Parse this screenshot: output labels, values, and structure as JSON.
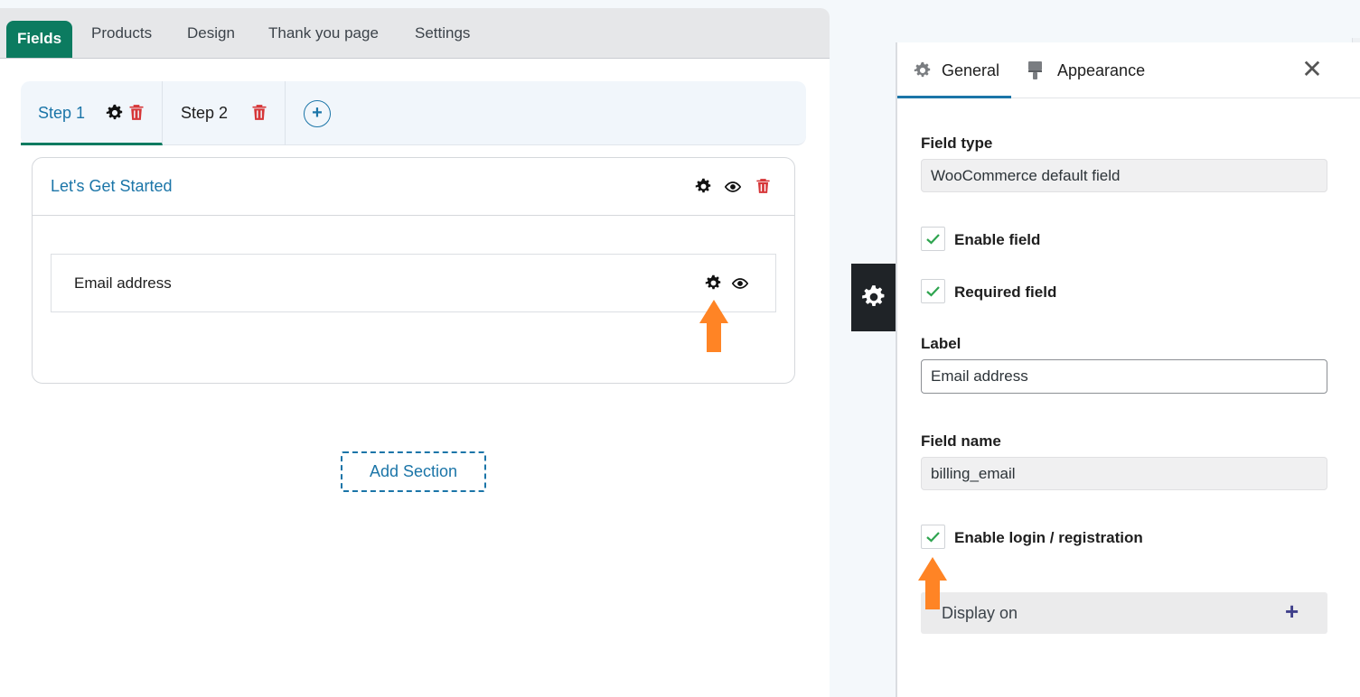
{
  "top_tabs": [
    "Fields",
    "Products",
    "Design",
    "Thank you page",
    "Settings"
  ],
  "steps": [
    {
      "label": "Step 1"
    },
    {
      "label": "Step 2"
    }
  ],
  "add_step_symbol": "+",
  "section": {
    "title": "Let's Get Started",
    "field_label": "Email address"
  },
  "add_section_label": "Add Section",
  "panel": {
    "tabs": {
      "general": "General",
      "appearance": "Appearance"
    },
    "close_symbol": "✕",
    "field_type_label": "Field type",
    "field_type_value": "WooCommerce default field",
    "enable_field_label": "Enable field",
    "required_field_label": "Required field",
    "label_label": "Label",
    "label_value": "Email address",
    "field_name_label": "Field name",
    "field_name_value": "billing_email",
    "enable_login_label": "Enable login / registration",
    "display_on_label": "Display on",
    "display_on_symbol": "+"
  },
  "colors": {
    "accent_green": "#0c7b60",
    "link_blue": "#1b75a8",
    "delete_red": "#d63638",
    "arrow_orange": "#ff8425",
    "check_green": "#2ea44f"
  },
  "icons": [
    "gear-icon",
    "trash-icon",
    "eye-icon",
    "plus-icon",
    "paint-brush-icon",
    "close-icon",
    "check-icon",
    "arrow-up-icon"
  ]
}
